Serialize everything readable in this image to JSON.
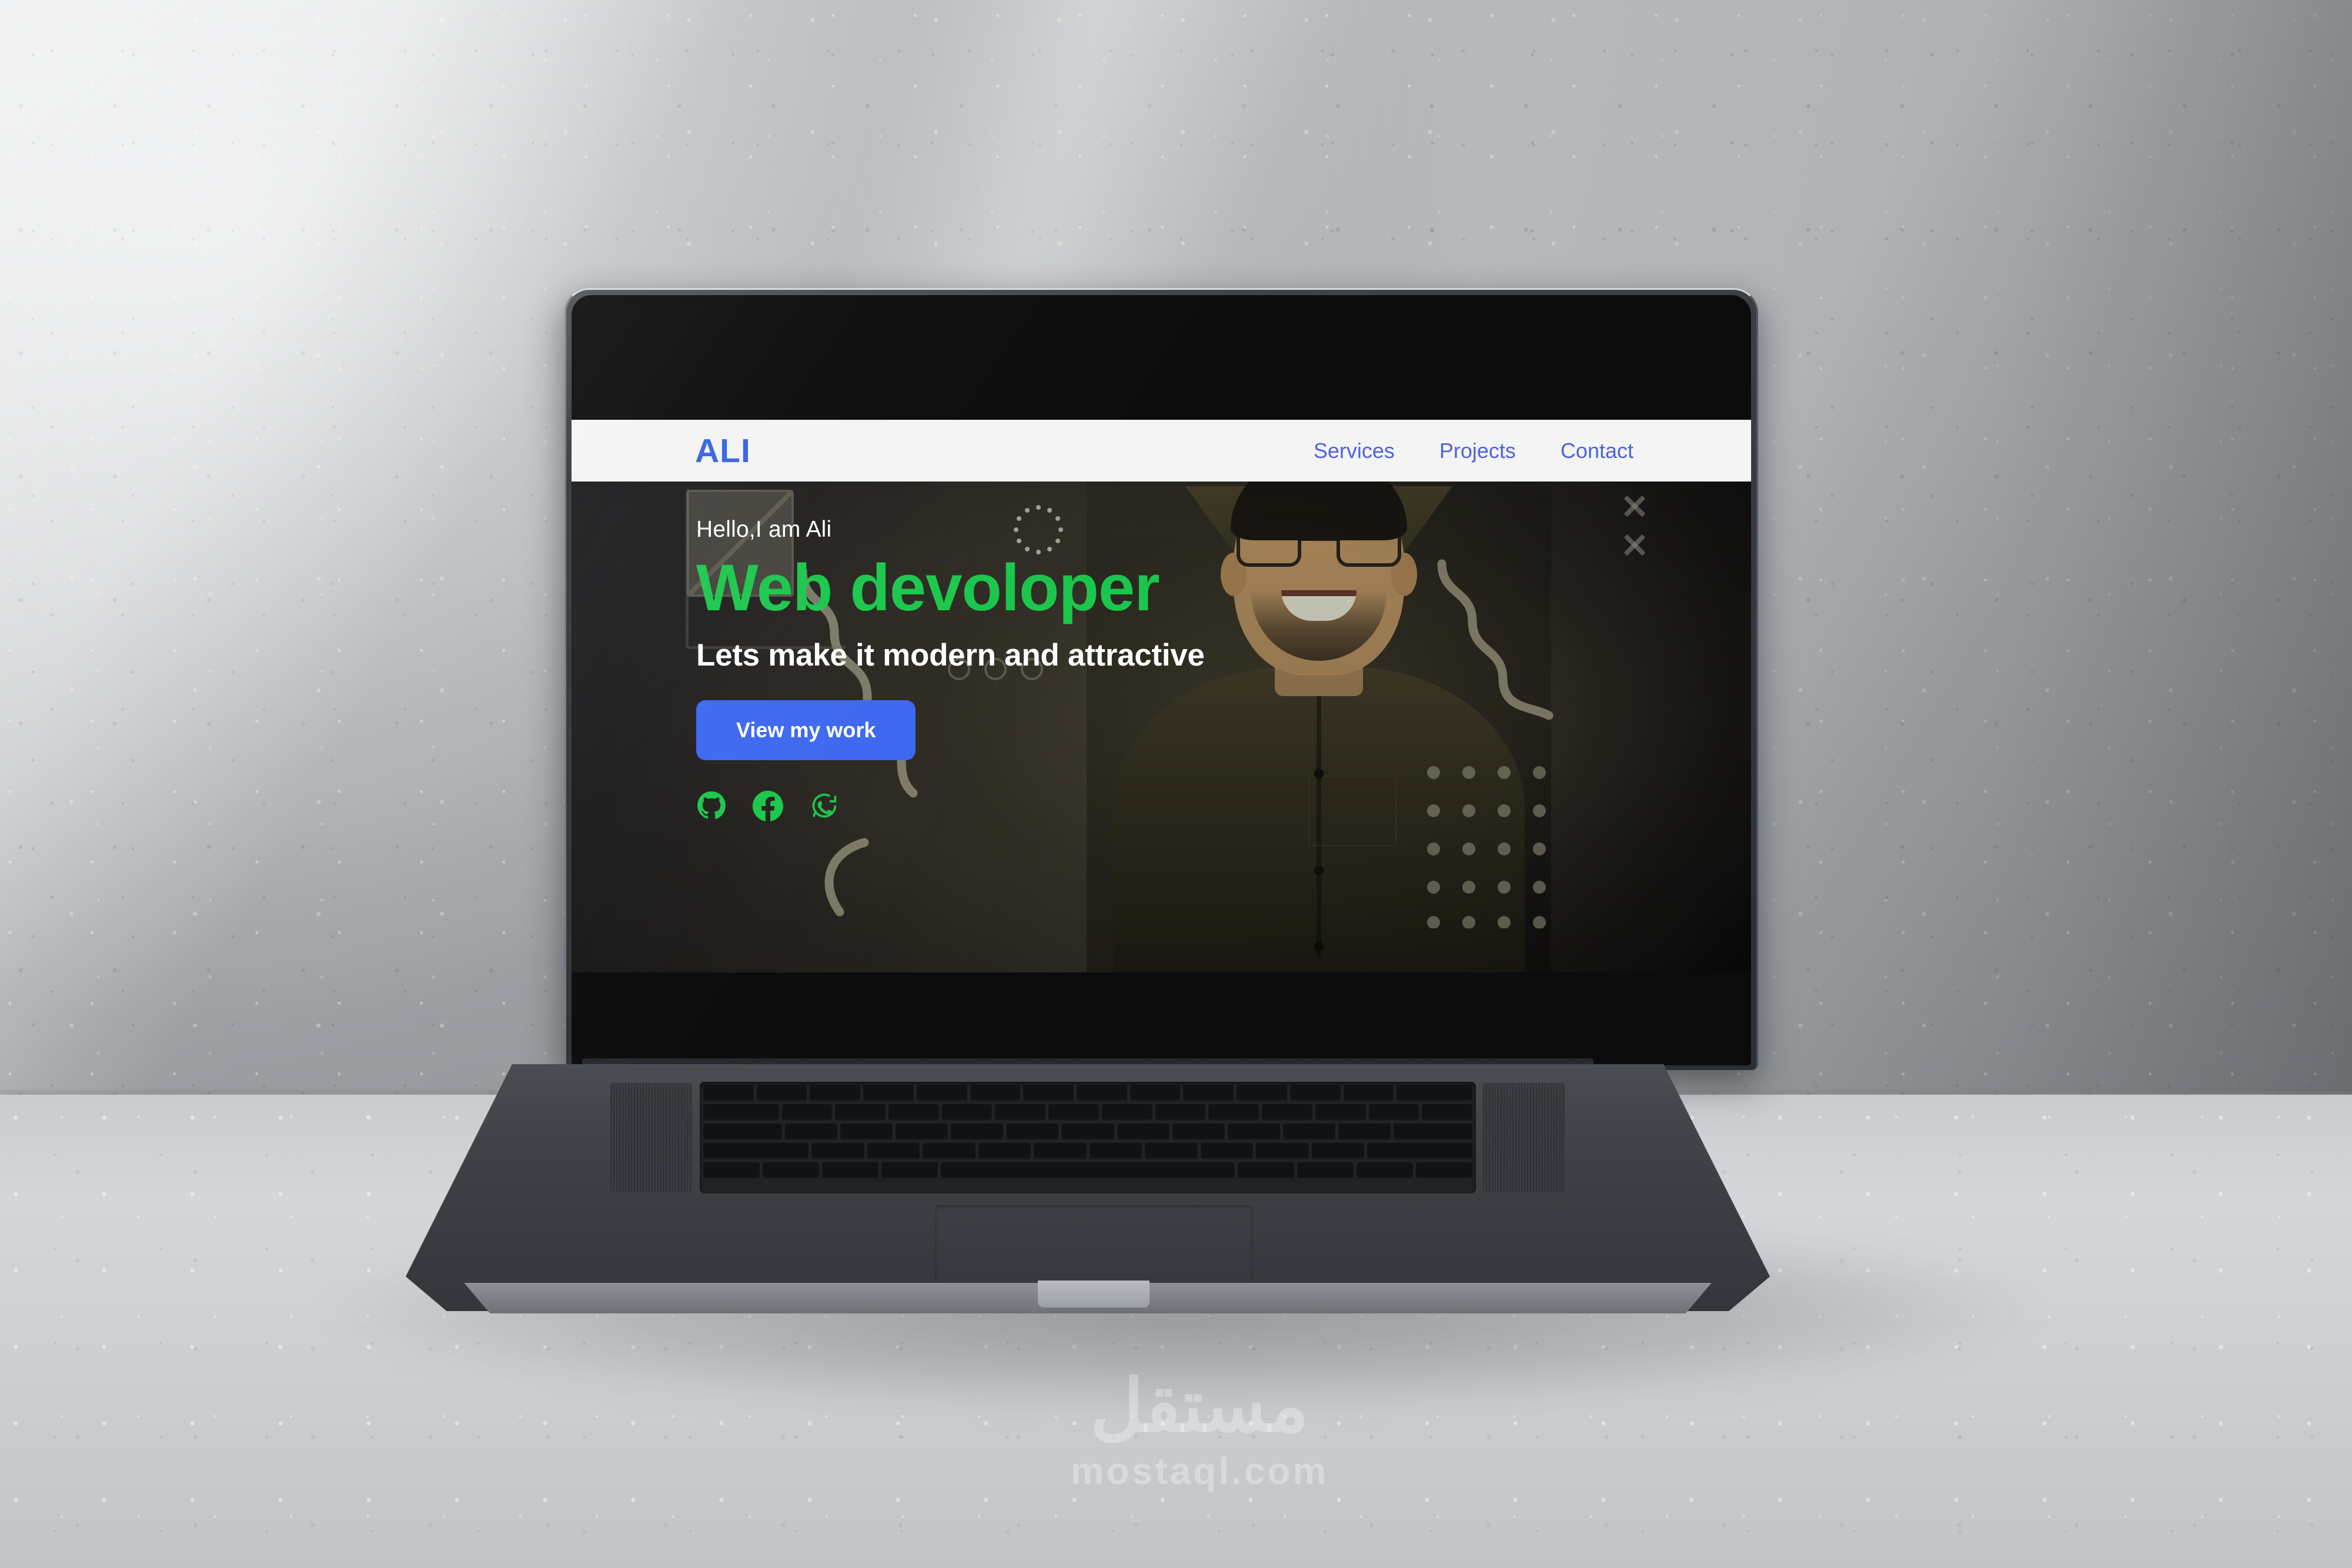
{
  "scene": {
    "device": "macbook-pro-laptop",
    "watermark": {
      "arabic": "مستقل",
      "domain": "mostaql.com"
    }
  },
  "site": {
    "navbar": {
      "logo": "ALI",
      "links": [
        {
          "label": "Services"
        },
        {
          "label": "Projects"
        },
        {
          "label": "Contact"
        }
      ]
    },
    "hero": {
      "greeting": "Hello,I am Ali",
      "title": "Web devoloper",
      "subtitle": "Lets make it modern and attractive",
      "cta_label": "View my work",
      "socials": [
        {
          "name": "github",
          "label": "GitHub"
        },
        {
          "name": "facebook",
          "label": "Facebook"
        },
        {
          "name": "whatsapp",
          "label": "WhatsApp"
        }
      ],
      "decorations": [
        {
          "name": "broken-image-placeholder"
        },
        {
          "name": "dotted-circle"
        },
        {
          "name": "outlined-circles",
          "count": 3
        },
        {
          "name": "squiggle-left"
        },
        {
          "name": "arc-left"
        },
        {
          "name": "squiggle-right"
        },
        {
          "name": "dot-grid",
          "columns": 4,
          "rows": 5
        },
        {
          "name": "x-mark",
          "count": 2
        }
      ]
    },
    "colors": {
      "nav_background": "#f4f4f4",
      "logo_blue": "#2f5fe0",
      "nav_link_blue": "#4f63df",
      "hero_green": "#19c64a",
      "cta_blue": "#3b66f0",
      "hero_text_white": "#ffffff",
      "social_green": "#19c64a",
      "hero_background_dark": "#2a2721"
    }
  }
}
